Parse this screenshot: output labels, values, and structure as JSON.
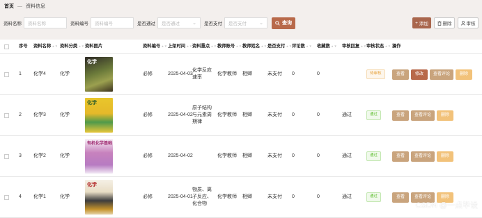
{
  "breadcrumb": {
    "home": "首页",
    "sep": "—",
    "current": "资料信息"
  },
  "filters": {
    "name_label": "资料名称",
    "name_placeholder": "资料名称",
    "code_label": "资料编号",
    "code_placeholder": "资料编号",
    "pass_label": "是否通过",
    "pass_placeholder": "是否通过",
    "pay_label": "是否支付",
    "pay_placeholder": "是否支付",
    "query_label": "查询"
  },
  "toolbar": {
    "add": "添加",
    "delete": "删除",
    "review": "审核"
  },
  "table": {
    "headers": [
      "序号",
      "资料名称",
      "资料分类",
      "资料图片",
      "资料编号",
      "上架时间",
      "资料重点",
      "教师账号",
      "教师姓名",
      "是否支付",
      "评论数",
      "收藏数",
      "审核回复",
      "审核状态",
      "操作"
    ],
    "rows": [
      {
        "idx": "1",
        "name": "化学4",
        "category": "化学",
        "cover_text": "化学",
        "code": "必修",
        "date": "2025-04-03",
        "focus": "化学反应速率",
        "teacher_acct": "化学教师",
        "teacher_name": "相卿",
        "paid": "未支付",
        "comments": "0",
        "favs": "0",
        "reply": "",
        "status": "待审核",
        "status_kind": "pending",
        "ops": [
          "查看",
          "修改",
          "查看评论",
          "删除"
        ]
      },
      {
        "idx": "2",
        "name": "化学3",
        "category": "化学",
        "cover_text": "化学",
        "code": "必修",
        "date": "2025-04-02",
        "focus": "原子结构与元素周期律",
        "teacher_acct": "化学教师",
        "teacher_name": "相卿",
        "paid": "未支付",
        "comments": "0",
        "favs": "0",
        "reply": "通过",
        "status": "通过",
        "status_kind": "ok",
        "ops": [
          "查看",
          "查看评论",
          "删除"
        ]
      },
      {
        "idx": "3",
        "name": "化学2",
        "category": "化学",
        "cover_text": "有机化学基础",
        "code": "必修",
        "date": "2025-04-02",
        "focus": "",
        "teacher_acct": "化学教师",
        "teacher_name": "相卿",
        "paid": "未支付",
        "comments": "0",
        "favs": "0",
        "reply": "通过",
        "status": "通过",
        "status_kind": "ok",
        "ops": [
          "查看",
          "查看评论",
          "删除"
        ]
      },
      {
        "idx": "4",
        "name": "化学1",
        "category": "化学",
        "cover_text": "化学",
        "code": "必修",
        "date": "2025-04-01",
        "focus": "物质、离子反应、化合物",
        "teacher_acct": "化学教师",
        "teacher_name": "相卿",
        "paid": "未支付",
        "comments": "0",
        "favs": "0",
        "reply": "通过",
        "status": "通过",
        "status_kind": "ok",
        "ops": [
          "查看",
          "查看评论",
          "删除"
        ]
      }
    ]
  },
  "watermark": "CSDN @一点毕设"
}
